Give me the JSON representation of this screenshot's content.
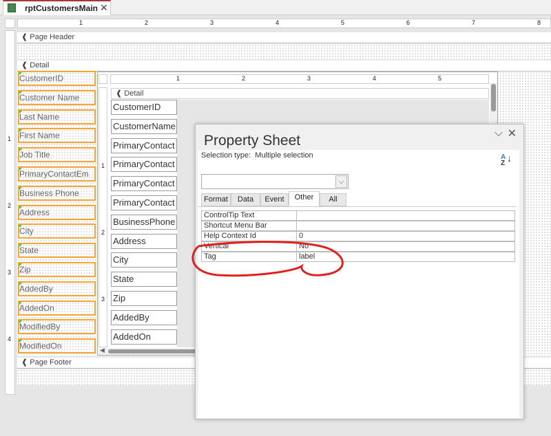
{
  "document_tab": {
    "title": "rptCustomersMain",
    "close": "✕"
  },
  "ruler_marks": [
    "1",
    "2",
    "3",
    "4",
    "5",
    "6",
    "7",
    "8"
  ],
  "vruler_marks": [
    "1",
    "2",
    "3",
    "4"
  ],
  "bands": {
    "page_header": "Page Header",
    "detail": "Detail",
    "page_footer": "Page Footer"
  },
  "main_labels": [
    "CustomerID",
    "Customer Name",
    "Last Name",
    "First Name",
    "Job Title",
    "PrimaryContactEm",
    "Business Phone",
    "Address",
    "City",
    "State",
    "Zip",
    "AddedBy",
    "AddedOn",
    "ModifiedBy",
    "ModifiedOn"
  ],
  "subreport": {
    "ruler_marks": [
      "1",
      "2",
      "3",
      "4",
      "5"
    ],
    "vruler_marks": [
      "1",
      "2",
      "3"
    ],
    "detail": "Detail",
    "labels": [
      "CustomerID",
      "CustomerName",
      "PrimaryContact",
      "PrimaryContact",
      "PrimaryContact",
      "PrimaryContact",
      "BusinessPhone",
      "Address",
      "City",
      "State",
      "Zip",
      "AddedBy",
      "AddedOn"
    ]
  },
  "property_sheet": {
    "title": "Property Sheet",
    "selection_type_label": "Selection type:",
    "selection_type_value": "Multiple selection",
    "dropdown_value": "",
    "tabs": [
      "Format",
      "Data",
      "Event",
      "Other",
      "All"
    ],
    "active_tab": "Other",
    "properties": [
      {
        "name": "ControlTip Text",
        "value": ""
      },
      {
        "name": "Shortcut Menu Bar",
        "value": ""
      },
      {
        "name": "Help Context Id",
        "value": "0"
      },
      {
        "name": "Vertical",
        "value": "No"
      },
      {
        "name": "Tag",
        "value": "label"
      }
    ]
  },
  "annotation": {
    "color": "#e0201c"
  },
  "colors": {
    "selection_border": "#f7a535",
    "tab_accent": "#a4373a"
  }
}
